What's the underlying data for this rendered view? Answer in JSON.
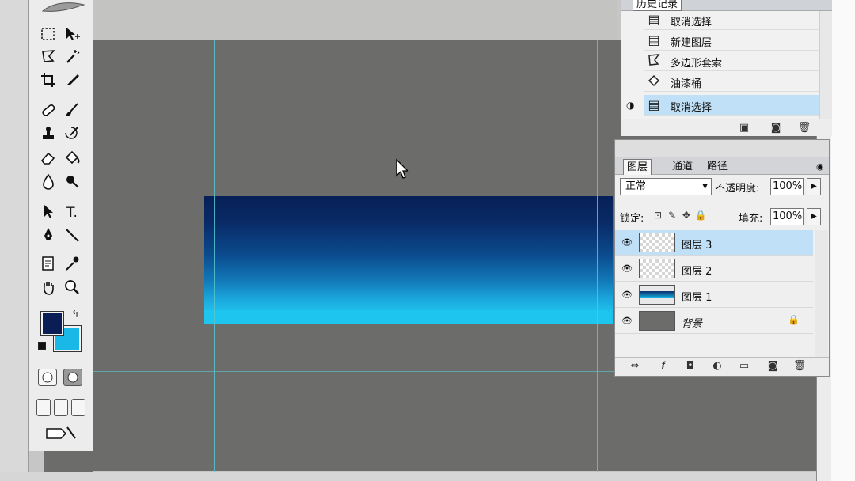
{
  "history": {
    "tab_label": "历史记录",
    "items": [
      {
        "label": "取消选择",
        "icon": "history-state-icon"
      },
      {
        "label": "新建图层",
        "icon": "history-state-icon"
      },
      {
        "label": "多边形套索",
        "icon": "polygonal-lasso-icon"
      },
      {
        "label": "油漆桶",
        "icon": "paint-bucket-icon"
      },
      {
        "label": "取消选择",
        "icon": "history-state-icon",
        "selected": true
      }
    ]
  },
  "layers": {
    "tabs": [
      "图层",
      "通道",
      "路径"
    ],
    "blend_mode": "正常",
    "opacity_label": "不透明度:",
    "opacity_value": "100%",
    "lock_label": "锁定:",
    "fill_label": "填充:",
    "fill_value": "100%",
    "items": [
      {
        "name": "图层 3",
        "thumb": "transparent",
        "selected": true
      },
      {
        "name": "图层 2",
        "thumb": "transparent"
      },
      {
        "name": "图层 1",
        "thumb": "gradient"
      },
      {
        "name": "背景",
        "thumb": "solid",
        "locked": true
      }
    ]
  },
  "colors": {
    "foreground": "#0a1d55",
    "background": "#19b8e6",
    "canvas": "#6c6d6b",
    "guide": "#57c6cf"
  },
  "toolbox": {
    "tools": [
      "marquee-tool",
      "move-tool",
      "lasso-tool",
      "magic-wand-tool",
      "crop-tool",
      "slice-tool",
      "healing-brush-tool",
      "brush-tool",
      "clone-stamp-tool",
      "history-brush-tool",
      "eraser-tool",
      "paint-bucket-tool",
      "blur-tool",
      "dodge-tool",
      "path-selection-tool",
      "type-tool",
      "pen-tool",
      "line-tool",
      "notes-tool",
      "eyedropper-tool",
      "hand-tool",
      "zoom-tool"
    ],
    "type_tool_glyph": "T."
  }
}
